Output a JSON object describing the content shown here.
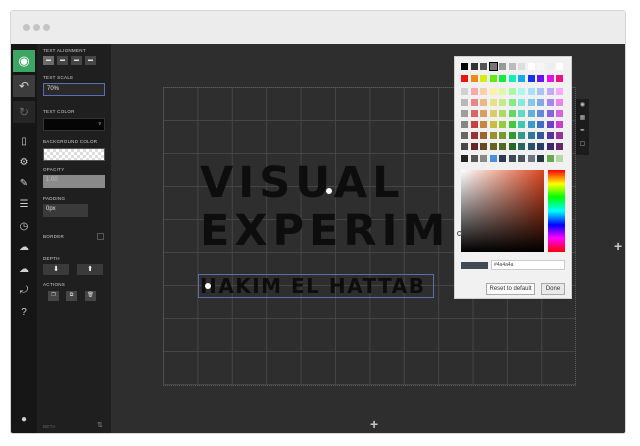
{
  "sidebar": {
    "text_alignment_label": "TEXT ALIGNMENT",
    "text_scale_label": "TEXT SCALE",
    "text_scale_value": "70%",
    "text_color_label": "TEXT COLOR",
    "background_color_label": "BACKGROUND COLOR",
    "opacity_label": "OPACITY",
    "opacity_value": "1.00",
    "padding_label": "PADDING",
    "padding_value": "0px",
    "border_label": "BORDER",
    "depth_label": "DEPTH",
    "actions_label": "ACTIONS",
    "footer_label": "BETA"
  },
  "canvas": {
    "headline_line1": "VISUAL",
    "headline_line2": "EXPERIMEN",
    "subline": "HAKIM EL HATTAB"
  },
  "color_picker": {
    "hex_value": "#4a4a4a",
    "reset_label": "Reset to default",
    "done_label": "Done",
    "preview_color": "#414a52",
    "hue_color": "#d9461f"
  },
  "icons": {
    "rail": [
      "eye-icon",
      "undo-icon",
      "redo-icon",
      "page-icon",
      "gear-icon",
      "brush-icon",
      "layers-icon",
      "clock-icon",
      "cloud-upload-icon",
      "cloud-download-icon",
      "share-icon",
      "help-icon",
      "user-icon"
    ],
    "add": "plus-icon"
  },
  "colors": {
    "accent_green": "#3fa564",
    "panel_dark": "#1f1f1f",
    "canvas_bg": "#2e2e2e"
  }
}
